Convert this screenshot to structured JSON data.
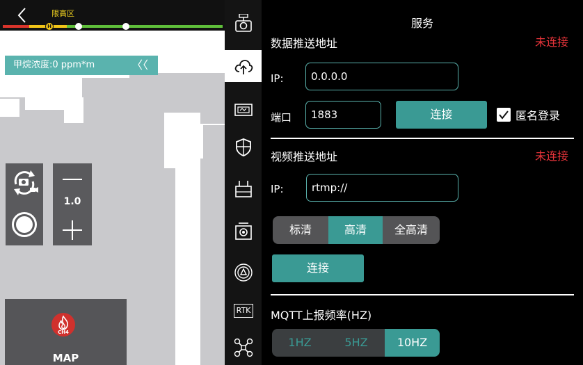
{
  "camera": {
    "zone_label": "限高区",
    "height_marker": "H",
    "gas_reading": "甲烷浓度:0 ppm*m",
    "gas_collapse": "〈〈",
    "zoom_value": "1.0",
    "map_label": "MAP",
    "ch4_label": "CH4"
  },
  "rail": {
    "rtk_label": "RTK",
    "items": [
      "camera-settings-icon",
      "cloud-upload-icon",
      "image-transmission-icon",
      "shield-icon",
      "remote-controller-icon",
      "gimbal-camera-icon",
      "obstacle-avoidance-icon",
      "rtk-icon",
      "drone-icon"
    ],
    "active_index": 1
  },
  "panel": {
    "title": "服务",
    "data_push": {
      "label": "数据推送地址",
      "status": "未连接",
      "ip_label": "IP:",
      "ip_value": "0.0.0.0",
      "port_label": "端口",
      "port_value": "1883",
      "connect_label": "连接",
      "anonymous_label": "匿名登录",
      "anonymous_checked": true
    },
    "video_push": {
      "label": "视频推送地址",
      "status": "未连接",
      "ip_label": "IP:",
      "ip_value": "rtmp://",
      "quality_options": [
        "标清",
        "高清",
        "全高清"
      ],
      "quality_selected": "高清",
      "connect_label": "连接"
    },
    "mqtt": {
      "label": "MQTT上报频率(HZ)",
      "options": [
        "1HZ",
        "5HZ",
        "10HZ"
      ],
      "selected": "10HZ"
    }
  },
  "colors": {
    "accent": "#3a9a94",
    "status_red": "#e8343a",
    "banner": "#5ab3ae",
    "zone_text": "#f1d21f"
  }
}
